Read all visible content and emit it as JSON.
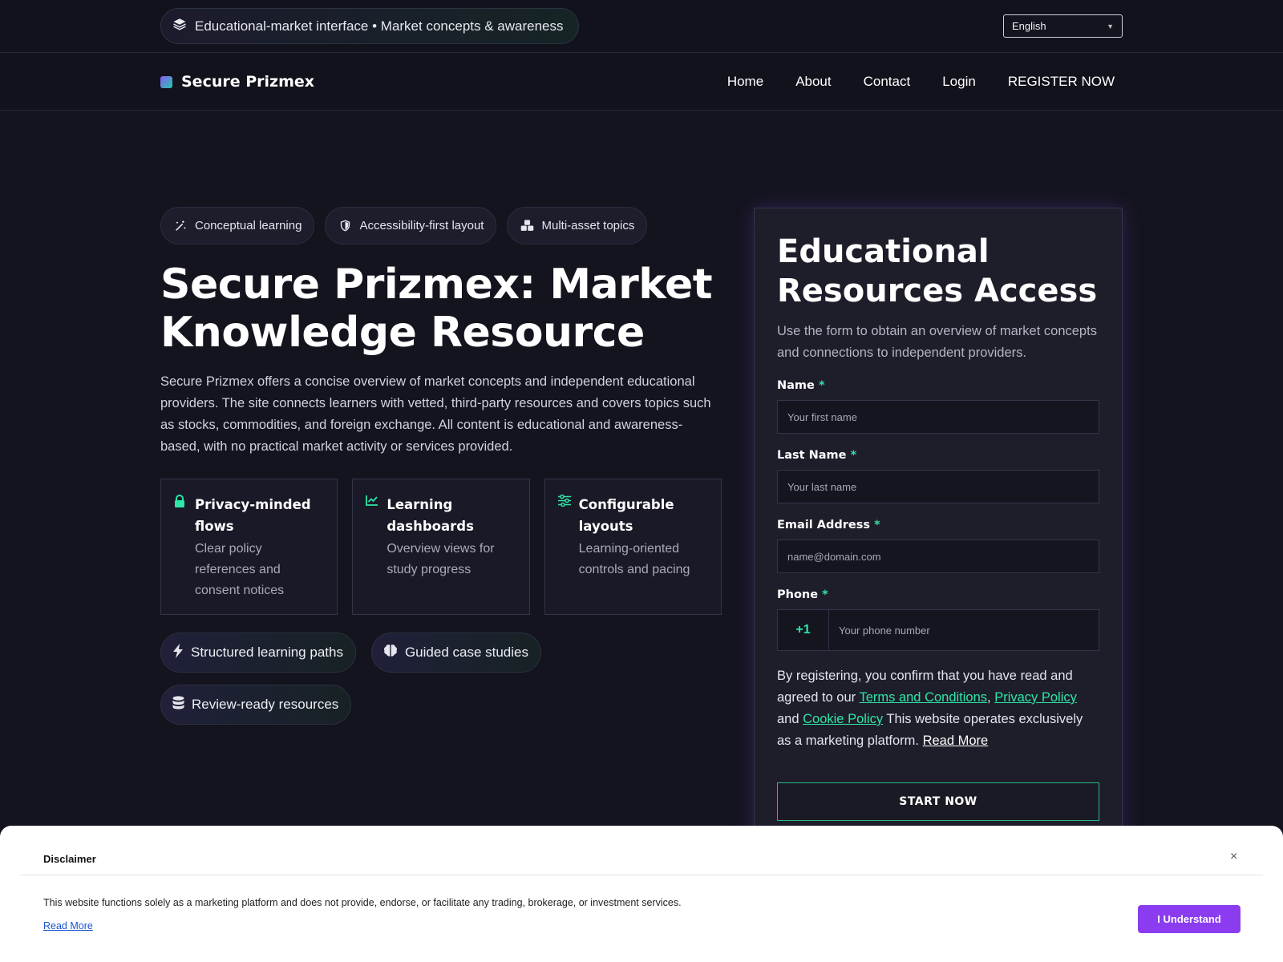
{
  "topbar": {
    "tagline": "Educational-market interface • Market concepts & awareness",
    "tagline_icon": "layers-icon",
    "language": "English"
  },
  "nav": {
    "brand": "Secure Prizmex",
    "items": [
      "Home",
      "About",
      "Contact",
      "Login",
      "REGISTER NOW"
    ]
  },
  "hero": {
    "chips": [
      {
        "label": "Conceptual learning",
        "icon": "magic-wand-icon"
      },
      {
        "label": "Accessibility-first layout",
        "icon": "shield-icon"
      },
      {
        "label": "Multi-asset topics",
        "icon": "cubes-icon"
      }
    ],
    "title": "Secure Prizmex: Market Knowledge Resource",
    "lead": "Secure Prizmex offers a concise overview of market concepts and independent educational providers. The site connects learners with vetted, third-party resources and covers topics such as stocks, commodities, and foreign exchange. All content is educational and awareness-based, with no practical market activity or services provided.",
    "features": [
      {
        "title": "Privacy-minded flows",
        "desc": "Clear policy references and consent notices",
        "icon": "lock-icon"
      },
      {
        "title": "Learning dashboards",
        "desc": "Overview views for study progress",
        "icon": "line-chart-icon"
      },
      {
        "title": "Configurable layouts",
        "desc": "Learning-oriented controls and pacing",
        "icon": "sliders-icon"
      }
    ],
    "chips2": [
      {
        "label": "Structured learning paths",
        "icon": "bolt-icon"
      },
      {
        "label": "Guided case studies",
        "icon": "brain-icon"
      },
      {
        "label": "Review-ready resources",
        "icon": "database-icon"
      }
    ]
  },
  "form": {
    "title": "Educational Resources Access",
    "subtitle": "Use the form to obtain an overview of market concepts and connections to independent providers.",
    "required_mark": "*",
    "name_label": "Name",
    "name_placeholder": "Your first name",
    "last_label": "Last Name",
    "last_placeholder": "Your last name",
    "email_label": "Email Address",
    "email_placeholder": "name@domain.com",
    "phone_label": "Phone",
    "phone_code": "+1",
    "phone_placeholder": "Your phone number",
    "consent_1": "By registering, you confirm that you have read and agreed to our ",
    "terms": "Terms and Conditions",
    "comma": ", ",
    "privacy": "Privacy Policy",
    "and": " and ",
    "cookie": "Cookie Policy",
    "consent_2": " This website operates exclusively as a marketing platform. ",
    "read_more": "Read More",
    "submit": "START NOW"
  },
  "disclaimer": {
    "title": "Disclaimer",
    "close": "×",
    "text": "This website functions solely as a marketing platform and does not provide, endorse, or facilitate any trading, brokerage, or investment services.",
    "read_more": "Read More",
    "button": "I Understand"
  },
  "colors": {
    "accent_green": "#2ee6a6",
    "accent_purple": "#8b3cf0",
    "background": "#14141f"
  }
}
